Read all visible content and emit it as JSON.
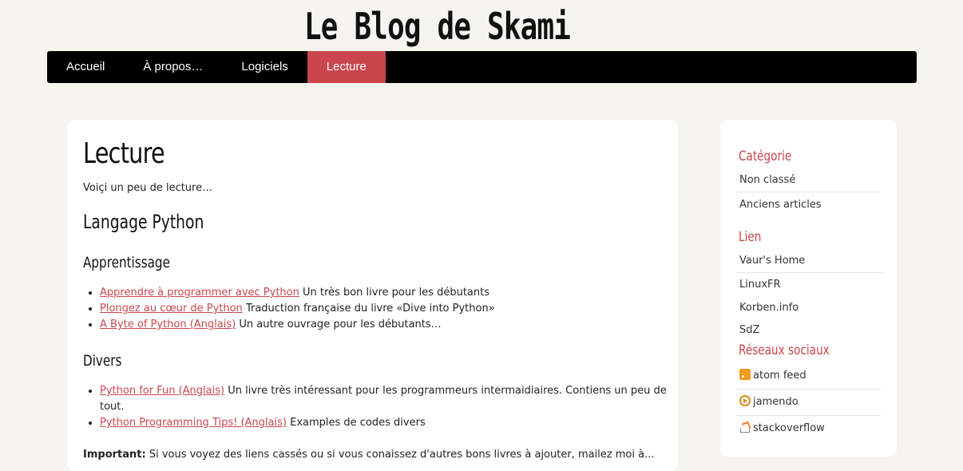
{
  "header": {
    "title": "Le Blog de Skami"
  },
  "nav": {
    "items": [
      {
        "label": "Accueil"
      },
      {
        "label": "À propos…"
      },
      {
        "label": "Logiciels"
      },
      {
        "label": "Lecture"
      }
    ],
    "active": "Lecture",
    "accent_color": "#c9464d"
  },
  "main": {
    "title": "Lecture",
    "intro": "Voiçi un peu de lecture…",
    "section_title": "Langage Python",
    "sub1": {
      "title": "Apprentissage",
      "items": [
        {
          "link": "Apprendre à programmer avec Python",
          "desc": "Un très bon livre pour les débutants"
        },
        {
          "link": "Plongez au cœur de Python",
          "desc": "Traduction française du livre «Dive into Python»"
        },
        {
          "link": "A Byte of Python (Anglais)",
          "desc": "Un autre ouvrage pour les débutants…"
        }
      ]
    },
    "sub2": {
      "title": "Divers",
      "items": [
        {
          "link": "Python for Fun (Anglais)",
          "desc": "Un livre très intéressant pour les programmeurs intermaidiaires. Contiens un peu de tout."
        },
        {
          "link": "Python Programming Tips! (Anglais)",
          "desc": "Examples de codes divers"
        }
      ]
    },
    "important_label": "Important:",
    "important_text": "Si vous voyez des liens cassés ou si vous conaissez d'autres bons livres à ajouter, mailez moi à..."
  },
  "sidebar": {
    "categories": {
      "title": "Catégorie",
      "items": [
        "Non classé",
        "Anciens articles"
      ]
    },
    "links": {
      "title": "Lien",
      "items": [
        "Vaur's Home",
        "LinuxFR",
        "Korben.info",
        "SdZ"
      ]
    },
    "social": {
      "title": "Réseaux sociaux",
      "items": [
        {
          "label": "atom feed",
          "icon": "rss-icon"
        },
        {
          "label": "jamendo",
          "icon": "jamendo-icon"
        },
        {
          "label": "stackoverflow",
          "icon": "stackoverflow-icon"
        }
      ]
    }
  }
}
